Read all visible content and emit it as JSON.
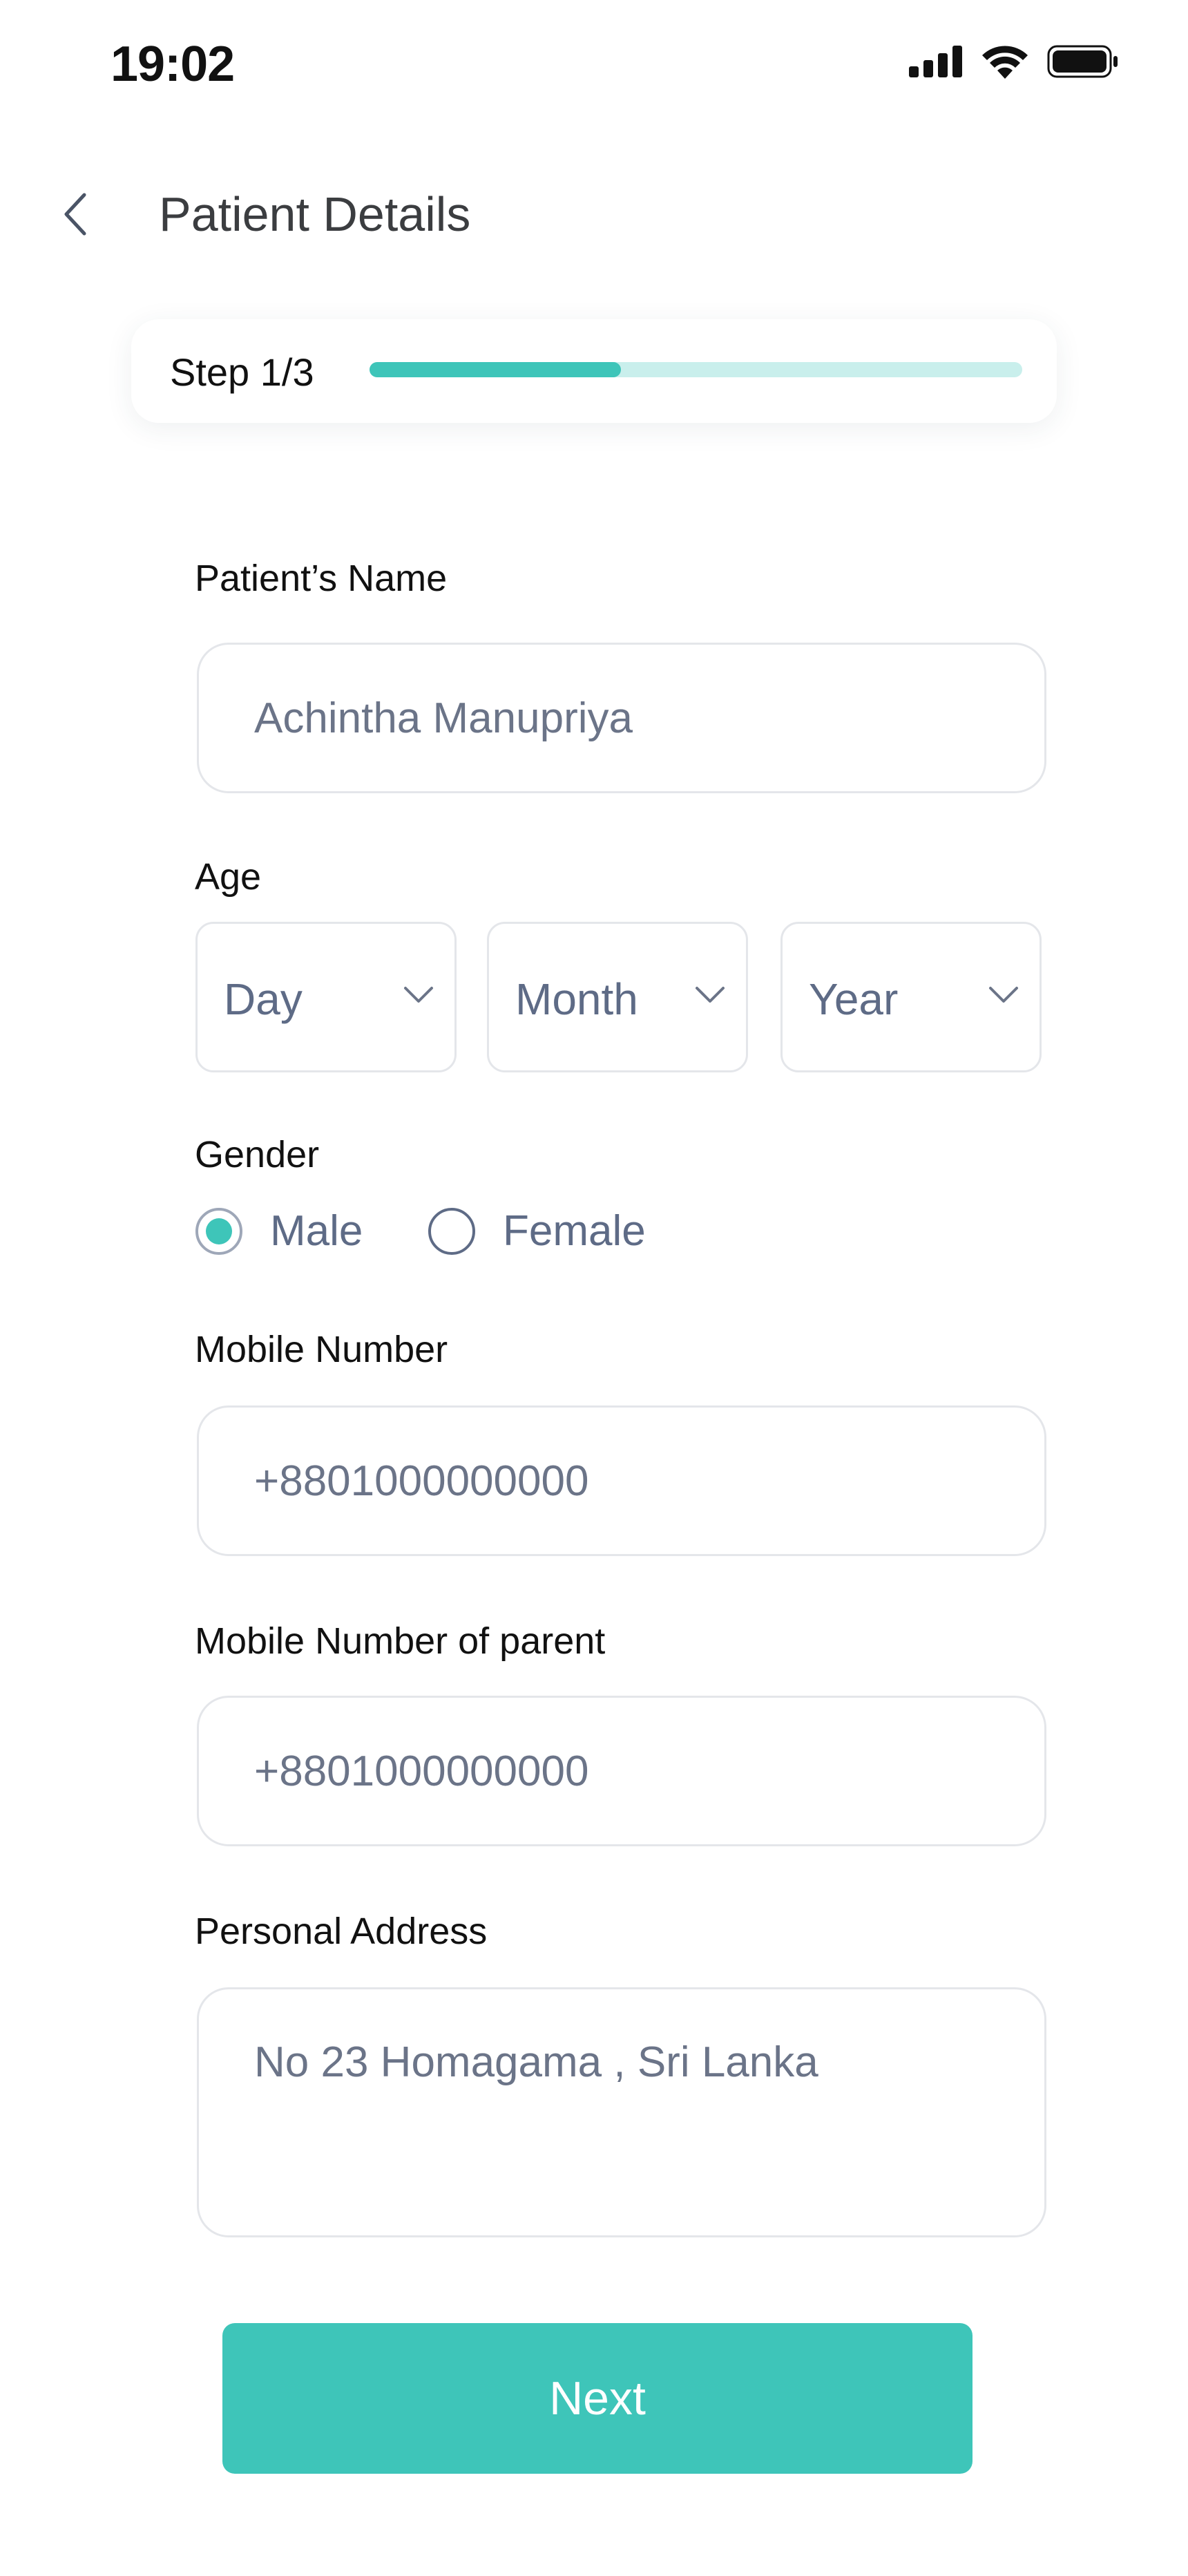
{
  "status_bar": {
    "time": "19:02",
    "icons": [
      "signal-icon",
      "wifi-icon",
      "battery-icon"
    ]
  },
  "header": {
    "title": "Patient Details",
    "back_icon": "chevron-left-icon"
  },
  "progress": {
    "label": "Step 1/3",
    "fraction": 0.385,
    "color": "#3ec5b9",
    "track_color": "#c9efec"
  },
  "form": {
    "name": {
      "label": "Patient’s Name",
      "value": "Achintha Manupriya"
    },
    "age": {
      "label": "Age",
      "day": "Day",
      "month": "Month",
      "year": "Year"
    },
    "gender": {
      "label": "Gender",
      "options": [
        "Male",
        "Female"
      ],
      "selected": "Male"
    },
    "mobile": {
      "label": "Mobile Number",
      "value": "+8801000000000"
    },
    "parent_mobile": {
      "label": "Mobile Number of parent",
      "value": "+8801000000000"
    },
    "address": {
      "label": "Personal Address",
      "value": "No 23 Homagama , Sri Lanka"
    }
  },
  "actions": {
    "next_label": "Next"
  },
  "colors": {
    "accent": "#3ec5b9",
    "text_muted": "#5e6b86",
    "border": "#e4e6ea"
  }
}
